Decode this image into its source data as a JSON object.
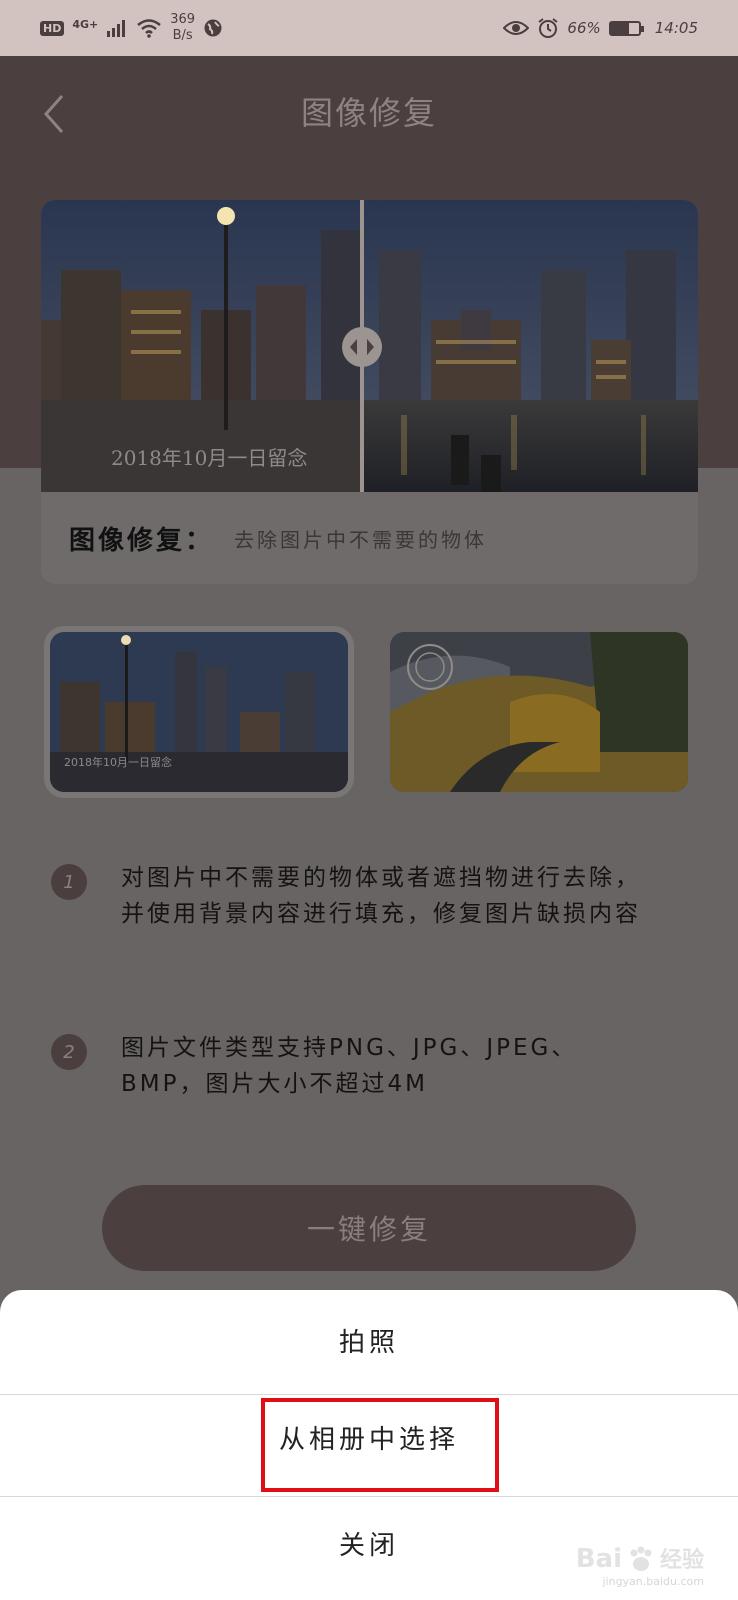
{
  "status_bar": {
    "hd": "HD",
    "network": "4G+",
    "speed_value": "369",
    "speed_unit": "B/s",
    "battery": "66%",
    "battery_level": 0.66,
    "time": "14:05"
  },
  "header": {
    "title": "图像修复"
  },
  "hero": {
    "image_caption": "2018年10月一日留念",
    "title": "图像修复：",
    "description": "去除图片中不需要的物体"
  },
  "thumbnails": {
    "first_caption": "2018年10月一日留念"
  },
  "steps": [
    {
      "number": "1",
      "text": "对图片中不需要的物体或者遮挡物进行去除，并使用背景内容进行填充，修复图片缺损内容"
    },
    {
      "number": "2",
      "text": "图片文件类型支持PNG、JPG、JPEG、BMP，图片大小不超过4M"
    }
  ],
  "actions": {
    "repair_label": "一键修复"
  },
  "sheet": {
    "take_photo": "拍照",
    "choose_album": "从相册中选择",
    "close": "关闭"
  },
  "watermark": {
    "brand": "Bai",
    "brand_suffix": "经验",
    "url": "jingyan.baidu.com"
  },
  "colors": {
    "header_bg": "#4b3f3f",
    "overlay_bg": "#696464",
    "highlight": "#e00f16"
  }
}
